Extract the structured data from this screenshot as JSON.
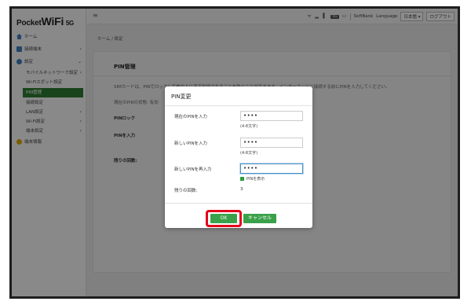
{
  "logo": {
    "pocket": "Pocket",
    "wifi": "WiFi",
    "model": "5G"
  },
  "sidebar": {
    "items": [
      {
        "label": "ホーム",
        "icon": "home-icon"
      },
      {
        "label": "接続端末",
        "icon": "devices-icon"
      },
      {
        "label": "設定",
        "icon": "gear-icon"
      },
      {
        "label": "モバイルネットワーク設定"
      },
      {
        "label": "Wi-Fiスポット設定"
      },
      {
        "label": "PIN管理"
      },
      {
        "label": "接続設定"
      },
      {
        "label": "LAN設定"
      },
      {
        "label": "Wi-Fi設定"
      },
      {
        "label": "端末設定"
      },
      {
        "label": "端末情報",
        "icon": "info-icon"
      }
    ]
  },
  "header": {
    "carrier": "SoftBank",
    "language_label": "Language",
    "language_value": "日本語",
    "logout": "ログアウト",
    "badge": "5G"
  },
  "breadcrumb": "ホーム / 設定",
  "page": {
    "title": "PIN管理",
    "description": "SIMカードは、PINでロックして他の人に不正利用されることを防ぐことができます。インターネットに接続する前にPINを入力してください。",
    "current_status": "現在のPINの状態: 有効",
    "row_pin_lock": "PINロック",
    "row_pin_input": "PINを入力",
    "row_remaining": "残りの回数:"
  },
  "modal": {
    "title": "PIN変更",
    "fields": [
      {
        "label": "現在のPINを入力",
        "value": "••••",
        "hint": "(4-8文字)"
      },
      {
        "label": "新しいPINを入力",
        "value": "••••",
        "hint": "(4-8文字)"
      },
      {
        "label": "新しいPINを再入力",
        "value": "••••"
      }
    ],
    "show_pin": "PINを表示",
    "remaining_label": "残りの回数:",
    "remaining_value": "3",
    "ok": "OK",
    "cancel": "キャンセル"
  },
  "colors": {
    "accent": "#3aa14a",
    "highlight": "#e3001b",
    "sidebar_active": "#2e7d32"
  }
}
